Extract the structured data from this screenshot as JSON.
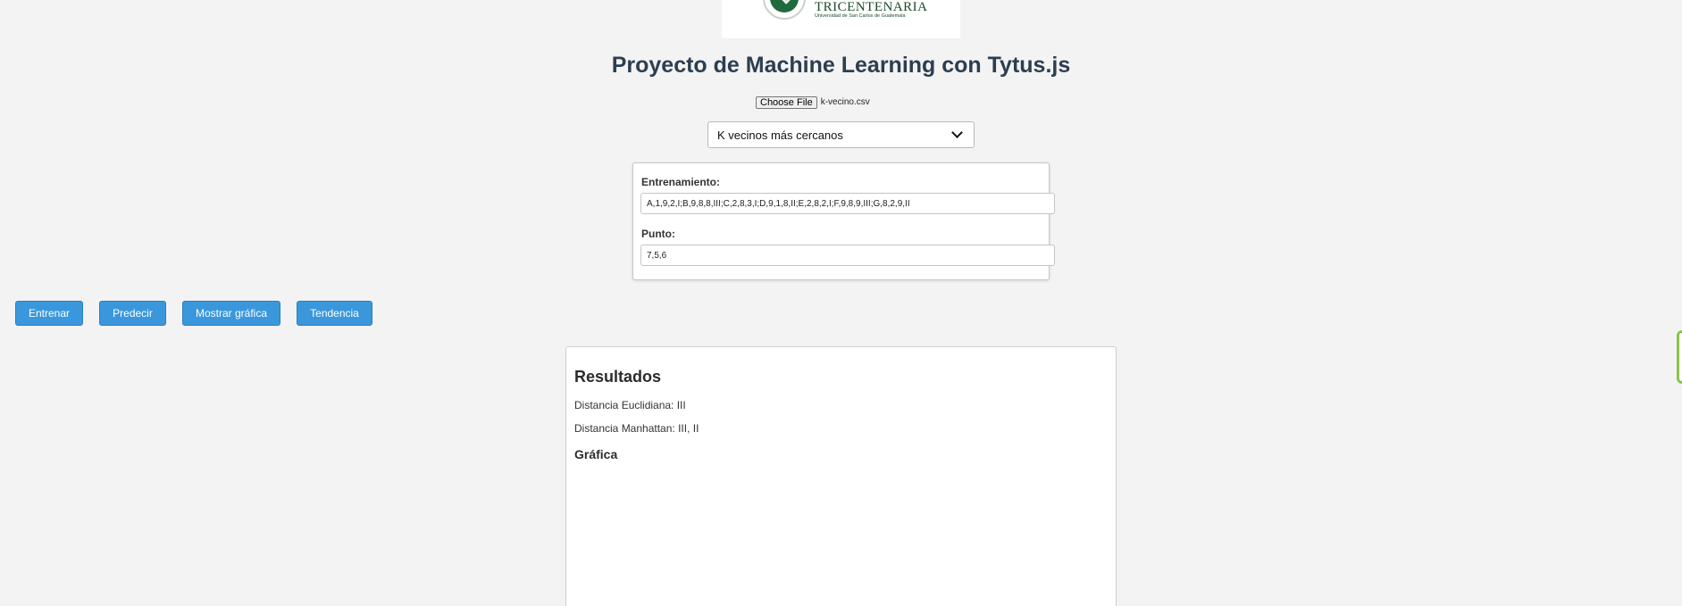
{
  "logo": {
    "text": "TRICENTENARIA",
    "subtext": "Universidad de San Carlos de Guatemala"
  },
  "page_title": "Proyecto de Machine Learning con Tytus.js",
  "file_input": {
    "button_label": "Choose File",
    "file_name": "k-vecino.csv"
  },
  "algorithm_select": {
    "selected": "K vecinos más cercanos"
  },
  "params": {
    "training_label": "Entrenamiento:",
    "training_value": "A,1,9,2,I;B,9,8,8,III;C,2,8,3,I;D,9,1,8,II;E,2,8,2,I;F,9,8,9,III;G,8,2,9,II",
    "point_label": "Punto:",
    "point_value": "7,5,6"
  },
  "actions": {
    "train": "Entrenar",
    "predict": "Predecir",
    "show_chart": "Mostrar gráfica",
    "trend": "Tendencia"
  },
  "results": {
    "title": "Resultados",
    "euclidean": "Distancia Euclidiana: III",
    "manhattan": "Distancia Manhattan: III, II",
    "chart_heading": "Gráfica"
  },
  "colors": {
    "accent": "#3a97dc",
    "title": "#2c3e50",
    "background": "#f3f3f3"
  }
}
